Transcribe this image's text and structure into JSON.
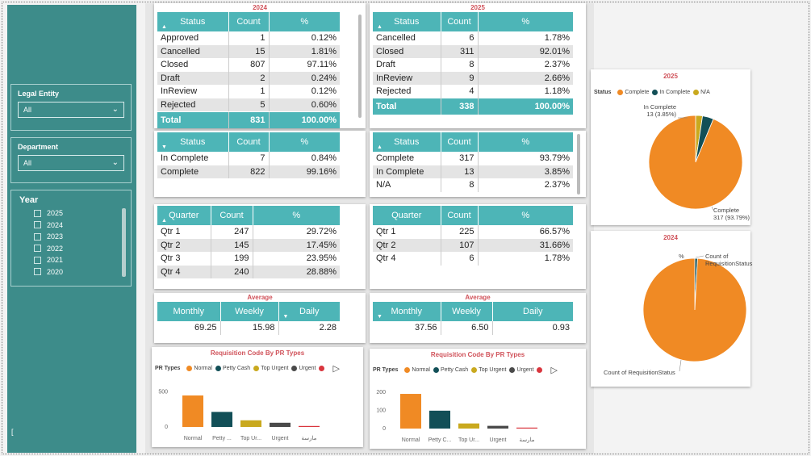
{
  "sidebar": {
    "legal_entity": {
      "label": "Legal Entity",
      "value": "All"
    },
    "department": {
      "label": "Department",
      "value": "All"
    },
    "year": {
      "label": "Year",
      "options": [
        "2025",
        "2024",
        "2023",
        "2022",
        "2021",
        "2020"
      ]
    },
    "footer_mark": "["
  },
  "t2024": {
    "title": "2024",
    "headers": [
      "Status",
      "Count",
      "%"
    ],
    "rows": [
      [
        "Approved",
        "1",
        "0.12%"
      ],
      [
        "Cancelled",
        "15",
        "1.81%"
      ],
      [
        "Closed",
        "807",
        "97.11%"
      ],
      [
        "Draft",
        "2",
        "0.24%"
      ],
      [
        "InReview",
        "1",
        "0.12%"
      ],
      [
        "Rejected",
        "5",
        "0.60%"
      ]
    ],
    "total": [
      "Total",
      "831",
      "100.00%"
    ]
  },
  "t2025": {
    "title": "2025",
    "headers": [
      "Status",
      "Count",
      "%"
    ],
    "rows": [
      [
        "Cancelled",
        "6",
        "1.78%"
      ],
      [
        "Closed",
        "311",
        "92.01%"
      ],
      [
        "Draft",
        "8",
        "2.37%"
      ],
      [
        "InReview",
        "9",
        "2.66%"
      ],
      [
        "Rejected",
        "4",
        "1.18%"
      ]
    ],
    "total": [
      "Total",
      "338",
      "100.00%"
    ]
  },
  "c2024": {
    "headers": [
      "Status",
      "Count",
      "%"
    ],
    "rows": [
      [
        "In Complete",
        "7",
        "0.84%"
      ],
      [
        "Complete",
        "822",
        "99.16%"
      ]
    ]
  },
  "c2025": {
    "headers": [
      "Status",
      "Count",
      "%"
    ],
    "rows": [
      [
        "Complete",
        "317",
        "93.79%"
      ],
      [
        "In Complete",
        "13",
        "3.85%"
      ],
      [
        "N/A",
        "8",
        "2.37%"
      ]
    ]
  },
  "q2024": {
    "headers": [
      "Quarter",
      "Count",
      "%"
    ],
    "rows": [
      [
        "Qtr 1",
        "247",
        "29.72%"
      ],
      [
        "Qtr 2",
        "145",
        "17.45%"
      ],
      [
        "Qtr 3",
        "199",
        "23.95%"
      ],
      [
        "Qtr 4",
        "240",
        "28.88%"
      ]
    ]
  },
  "q2025": {
    "headers": [
      "Quarter",
      "Count",
      "%"
    ],
    "rows": [
      [
        "Qtr 1",
        "225",
        "66.57%"
      ],
      [
        "Qtr 2",
        "107",
        "31.66%"
      ],
      [
        "Qtr 4",
        "6",
        "1.78%"
      ]
    ]
  },
  "avg2024": {
    "title": "Average",
    "headers": [
      "Monthly",
      "Weekly",
      "Daily"
    ],
    "values": [
      "69.25",
      "15.98",
      "2.28"
    ]
  },
  "avg2025": {
    "title": "Average",
    "headers": [
      "Monthly",
      "Weekly",
      "Daily"
    ],
    "values": [
      "37.56",
      "6.50",
      "0.93"
    ]
  },
  "bar_legend": {
    "title": "PR Types",
    "items": [
      {
        "name": "Normal",
        "color": "#f08a24"
      },
      {
        "name": "Petty Cash",
        "color": "#124f57"
      },
      {
        "name": "Top Urgent",
        "color": "#c9a91e"
      },
      {
        "name": "Urgent",
        "color": "#4a4a4a"
      },
      {
        "name": "",
        "color": "#d9363e"
      }
    ]
  },
  "pie_legend": {
    "title": "Status",
    "items": [
      {
        "name": "Complete",
        "color": "#f08a24"
      },
      {
        "name": "In Complete",
        "color": "#124f57"
      },
      {
        "name": "N/A",
        "color": "#c9a91e"
      }
    ]
  },
  "pie2025_labels": {
    "top_name": "In Complete",
    "top_val": "13 (3.85%)",
    "bottom_name": "Complete",
    "bottom_val": "317 (93.79%)"
  },
  "pie2024_labels": {
    "top_pct": "%",
    "top_name": "Count of RequisitionStatus",
    "bottom_name": "Count of RequisitionStatus"
  },
  "chart_data": [
    {
      "type": "bar",
      "title": "Requisition Code By PR Types",
      "categories": [
        "Normal",
        "Petty ...",
        "Top Ur...",
        "Urgent",
        "مارسة"
      ],
      "values": [
        450,
        215,
        95,
        60,
        10
      ],
      "ylim": [
        0,
        600
      ],
      "yticks": [
        0,
        500
      ],
      "colors": [
        "#f08a24",
        "#124f57",
        "#c9a91e",
        "#4a4a4a",
        "#d9363e"
      ]
    },
    {
      "type": "bar",
      "title": "Requisition Code By PR Types",
      "categories": [
        "Normal",
        "Petty C...",
        "Top Ur...",
        "Urgent",
        "مارسة"
      ],
      "values": [
        190,
        98,
        28,
        15,
        5
      ],
      "ylim": [
        0,
        230
      ],
      "yticks": [
        0,
        100,
        200
      ],
      "colors": [
        "#f08a24",
        "#124f57",
        "#c9a91e",
        "#4a4a4a",
        "#d9363e"
      ]
    },
    {
      "type": "pie",
      "title": "2025",
      "labels": [
        "Complete",
        "In Complete",
        "N/A"
      ],
      "values": [
        317,
        13,
        8
      ],
      "colors": [
        "#f08a24",
        "#124f57",
        "#c9a91e"
      ]
    },
    {
      "type": "pie",
      "title": "2024",
      "labels": [
        "Complete",
        "In Complete"
      ],
      "values": [
        822,
        7
      ],
      "colors": [
        "#f08a24",
        "#124f57"
      ]
    }
  ]
}
